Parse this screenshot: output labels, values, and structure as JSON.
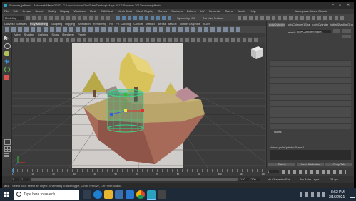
{
  "window": {
    "title": "Summer_jeff.mb* - Autodesk Maya 2017 - C:\\Users\\admin\\OneDrive\\Desktop\\Maya 2017\\ Summer 2017\\scenes\\jeff.mb",
    "workspace_label": "Workspace: Maya Classic"
  },
  "menus": [
    "File",
    "Edit",
    "Create",
    "Select",
    "Modify",
    "Display",
    "Windows",
    "Mesh",
    "Edit Mesh",
    "Mesh Tools",
    "Mesh Display",
    "Curves",
    "Surfaces",
    "Deform",
    "UV",
    "Generate",
    "Cache",
    "Arnold",
    "Help"
  ],
  "status": {
    "mode": "Modeling",
    "symmetry": "Symmetry: Off",
    "live": "No Live Surface"
  },
  "shelf_tabs": [
    "Curves / Surfaces",
    "Poly Modeling",
    "Sculpting",
    "Rigging",
    "Animation",
    "Rendering",
    "FX",
    "FX Caching",
    "Custom",
    "Arnold",
    "Bifrost",
    "MASH",
    "Motion Graphics",
    "XGen"
  ],
  "panel_menu": [
    "View",
    "Shading",
    "Lighting",
    "Show",
    "Renderer",
    "Panels"
  ],
  "attribute_editor": {
    "tabs": [
      "polyCylinder1",
      "polyCylinder1Shape",
      "polyCylinder1",
      "initialShadingGroup"
    ],
    "field_label": "mesh:",
    "field_value": "polyCylinderShape1",
    "sections": [
      "Transform Attributes",
      "Mesh Component Display",
      "Mesh Controls",
      "Tangent Space",
      "Smooth Mesh",
      "Displacement Map",
      "Render Stats",
      "Object Display",
      "Node Behavior",
      "UUID",
      "Extra Attributes",
      "Notes"
    ],
    "notes_label": "Notes: polyCylinderShape1",
    "buttons": [
      "Select",
      "Load Attributes",
      "Copy Tab"
    ]
  },
  "timeline": {
    "ticks": [
      "1",
      "5",
      "10",
      "15",
      "20",
      "25",
      "30",
      "35",
      "40",
      "45",
      "50",
      "55",
      "60",
      "65",
      "70",
      "75",
      "80",
      "85",
      "90",
      "95",
      "100",
      "105",
      "110",
      "115",
      "120"
    ],
    "current_frame": "1",
    "start": "1",
    "end": "120",
    "range_end": "200",
    "char_set": "No Character Set",
    "anim_layer": "No Anim Layer",
    "fps": "24 fps"
  },
  "cmdline": {
    "lang": "MEL",
    "help": "Select Tool: select an object. Shift+drag to add/toggle, Ctrl to remove, Ctrl+Shift to add."
  },
  "taskbar": {
    "search_placeholder": "Type here to search",
    "time": "8:52 PM",
    "date": "2/16/2021"
  },
  "colors": {
    "maya_bg": "#444444",
    "viewport_bg": "#3c3c3c",
    "taskbar": "#1e2a38",
    "selection_green": "#39d98a"
  }
}
